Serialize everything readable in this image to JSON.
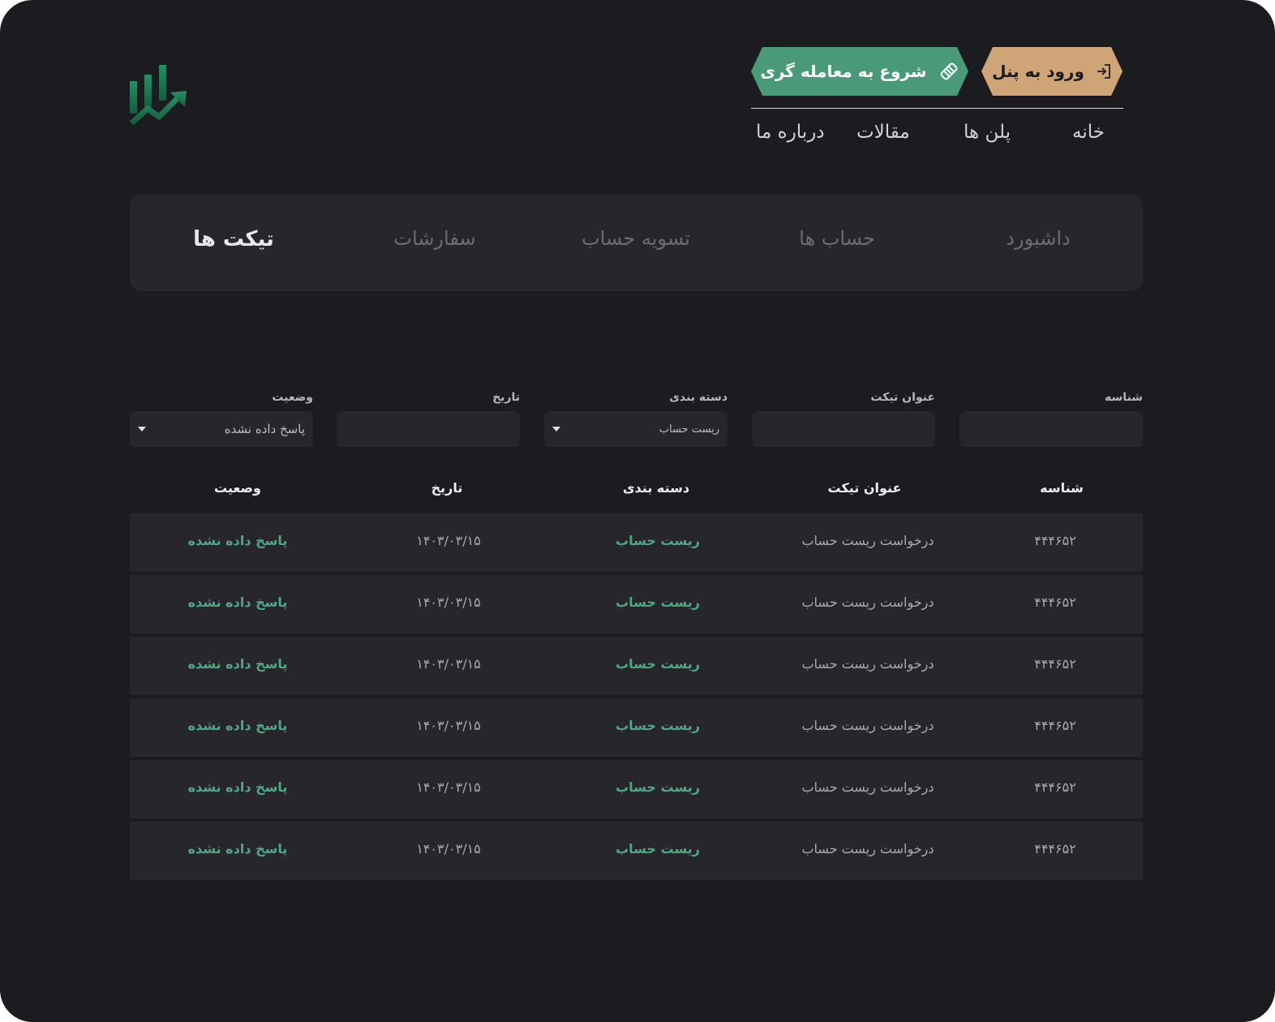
{
  "header": {
    "panel_button": "ورود به پنل",
    "trade_button": "شروع به معامله گری",
    "nav": [
      "خانه",
      "پلن ها",
      "مقالات",
      "درباره ما"
    ]
  },
  "tabs": [
    "داشبورد",
    "حساب ها",
    "تسویه حساب",
    "سفارشات",
    "تیکت ها"
  ],
  "active_tab": "تیکت ها",
  "filters": {
    "id_label": "شناسه",
    "title_label": "عنوان تیکت",
    "category_label": "دسته بندی",
    "category_value": "ریست حساب",
    "date_label": "تاریخ",
    "status_label": "وضعیت",
    "status_value": "پاسخ داده نشده"
  },
  "table": {
    "headers": [
      "شناسه",
      "عنوان تیکت",
      "دسته بندی",
      "تاریخ",
      "وصعیت"
    ],
    "rows": [
      {
        "id": "۴۴۴۶۵۲",
        "title": "درخواست ریست حساب",
        "category": "ریست حساب",
        "date": "۱۴۰۳/۰۳/۱۵",
        "status": "پاسخ داده نشده"
      },
      {
        "id": "۴۴۴۶۵۲",
        "title": "درخواست ریست حساب",
        "category": "ریست حساب",
        "date": "۱۴۰۳/۰۳/۱۵",
        "status": "پاسخ داده نشده"
      },
      {
        "id": "۴۴۴۶۵۲",
        "title": "درخواست ریست حساب",
        "category": "ریست حساب",
        "date": "۱۴۰۳/۰۳/۱۵",
        "status": "پاسخ داده نشده"
      },
      {
        "id": "۴۴۴۶۵۲",
        "title": "درخواست ریست حساب",
        "category": "ریست حساب",
        "date": "۱۴۰۳/۰۳/۱۵",
        "status": "پاسخ داده نشده"
      },
      {
        "id": "۴۴۴۶۵۲",
        "title": "درخواست ریست حساب",
        "category": "ریست حساب",
        "date": "۱۴۰۳/۰۳/۱۵",
        "status": "پاسخ داده نشده"
      },
      {
        "id": "۴۴۴۶۵۲",
        "title": "درخواست ریست حساب",
        "category": "ریست حساب",
        "date": "۱۴۰۳/۰۳/۱۵",
        "status": "پاسخ داده نشده"
      }
    ]
  },
  "colors": {
    "background": "#1b1b20",
    "panel": "#26262c",
    "accent_green": "#4a9a7a",
    "accent_gold": "#cfa577"
  },
  "icons": {
    "logo": "chart-bars-arrow-logo",
    "panel_button": "login-icon",
    "trade_button": "handshake-icon",
    "dropdown": "caret-down-icon"
  }
}
